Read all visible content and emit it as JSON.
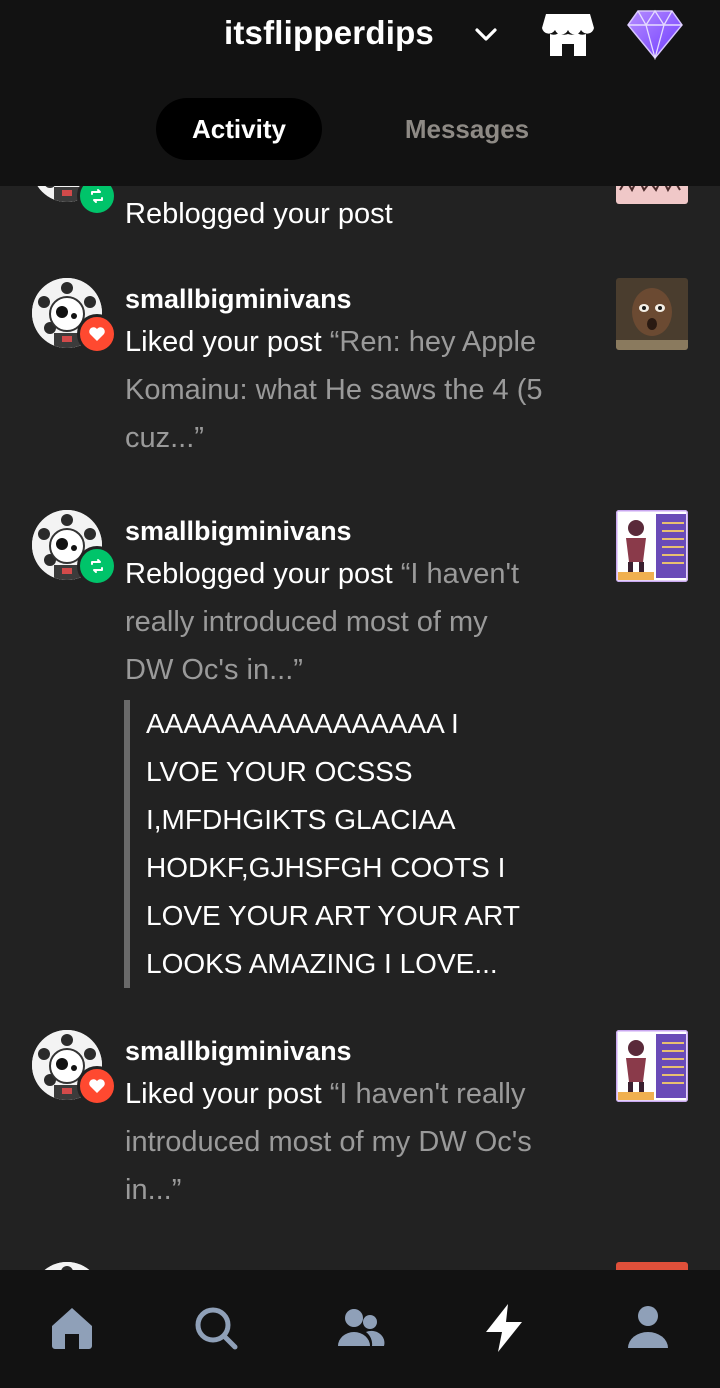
{
  "header": {
    "blog_name": "itsflipperdips",
    "tabs": {
      "activity": "Activity",
      "messages": "Messages"
    },
    "active_tab": "activity",
    "icons": [
      "chevron-down-icon",
      "shop-icon",
      "gem-icon"
    ]
  },
  "feed": {
    "partial_top": {
      "action": "Reblogged your post",
      "badge": "reblog"
    },
    "items": [
      {
        "username": "smallbigminivans",
        "action": "Liked your post",
        "post_excerpt_lines": [
          "“Ren: hey Apple",
          "Komainu: what He saws the 4 (5",
          "cuz...”"
        ],
        "badge": "like",
        "thumbnail": "face-photo"
      },
      {
        "username": "smallbigminivans",
        "action": "Reblogged your post",
        "post_excerpt_lines": [
          "“I haven't",
          "really introduced most of my",
          "DW Oc's in...”"
        ],
        "badge": "reblog",
        "thumbnail": "character-art",
        "comment": "AAAAAAAAAAAAAAAA I\nLVOE YOUR OCSSS\nI,MFDHGIKTS GLACIAA\nHODKF,GJHSFGH COOTS I\nLOVE YOUR ART YOUR ART\nLOOKS AMAZING I LOVE..."
      },
      {
        "username": "smallbigminivans",
        "action": "Liked your post",
        "post_excerpt_lines": [
          "“I haven't really",
          "introduced most of my DW Oc's",
          "in...”"
        ],
        "badge": "like",
        "thumbnail": "character-art"
      }
    ]
  },
  "bottom_nav": {
    "items": [
      "home-icon",
      "search-icon",
      "community-icon",
      "activity-icon",
      "account-icon"
    ],
    "active": "activity-icon"
  },
  "colors": {
    "background": "#222222",
    "header_bg": "#121212",
    "reblog_green": "#00c46a",
    "like_red": "#ff4930",
    "muted_text": "#9a9a9a",
    "nav_icon": "#8fa0b8"
  }
}
